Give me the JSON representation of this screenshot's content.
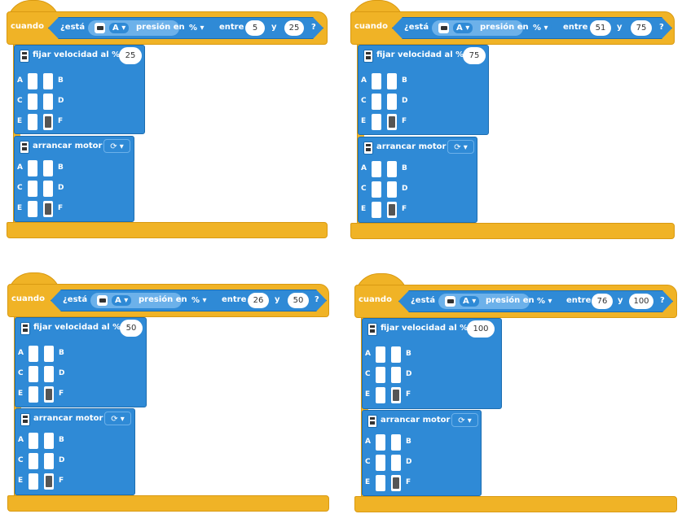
{
  "programs": [
    {
      "hat_label": "cuando",
      "question_prefix": "¿está",
      "port": "A",
      "sensor_label": "presión en",
      "unit": "%",
      "between_label": "entre",
      "low": "5",
      "and_label": "y",
      "high": "25",
      "qmark": "?",
      "speed_label": "fijar velocidad al %",
      "speed_value": "25",
      "start_label": "arrancar motor",
      "direction_icon": "rotate-cw-icon",
      "port_labels": [
        "A",
        "B",
        "C",
        "D",
        "E",
        "F"
      ]
    },
    {
      "hat_label": "cuando",
      "question_prefix": "¿está",
      "port": "A",
      "sensor_label": "presión en",
      "unit": "%",
      "between_label": "entre",
      "low": "51",
      "and_label": "y",
      "high": "75",
      "qmark": "?",
      "speed_label": "fijar velocidad al %",
      "speed_value": "75",
      "start_label": "arrancar motor",
      "direction_icon": "rotate-cw-icon",
      "port_labels": [
        "A",
        "B",
        "C",
        "D",
        "E",
        "F"
      ]
    },
    {
      "hat_label": "cuando",
      "question_prefix": "¿está",
      "port": "A",
      "sensor_label": "presión en",
      "unit": "%",
      "between_label": "entre",
      "low": "26",
      "and_label": "y",
      "high": "50",
      "qmark": "?",
      "speed_label": "fijar velocidad al %",
      "speed_value": "50",
      "start_label": "arrancar motor",
      "direction_icon": "rotate-cw-icon",
      "port_labels": [
        "A",
        "B",
        "C",
        "D",
        "E",
        "F"
      ]
    },
    {
      "hat_label": "cuando",
      "question_prefix": "¿está",
      "port": "A",
      "sensor_label": "presión en",
      "unit": "%",
      "between_label": "entre",
      "low": "76",
      "and_label": "y",
      "high": "100",
      "qmark": "?",
      "speed_label": "fijar velocidad al %",
      "speed_value": "100",
      "start_label": "arrancar motor",
      "direction_icon": "rotate-cw-icon",
      "port_labels": [
        "A",
        "B",
        "C",
        "D",
        "E",
        "F"
      ]
    }
  ],
  "colors": {
    "event_yellow": "#f0b326",
    "motor_blue": "#2f8ad6",
    "sensor_light_blue": "#6cb1ea"
  }
}
